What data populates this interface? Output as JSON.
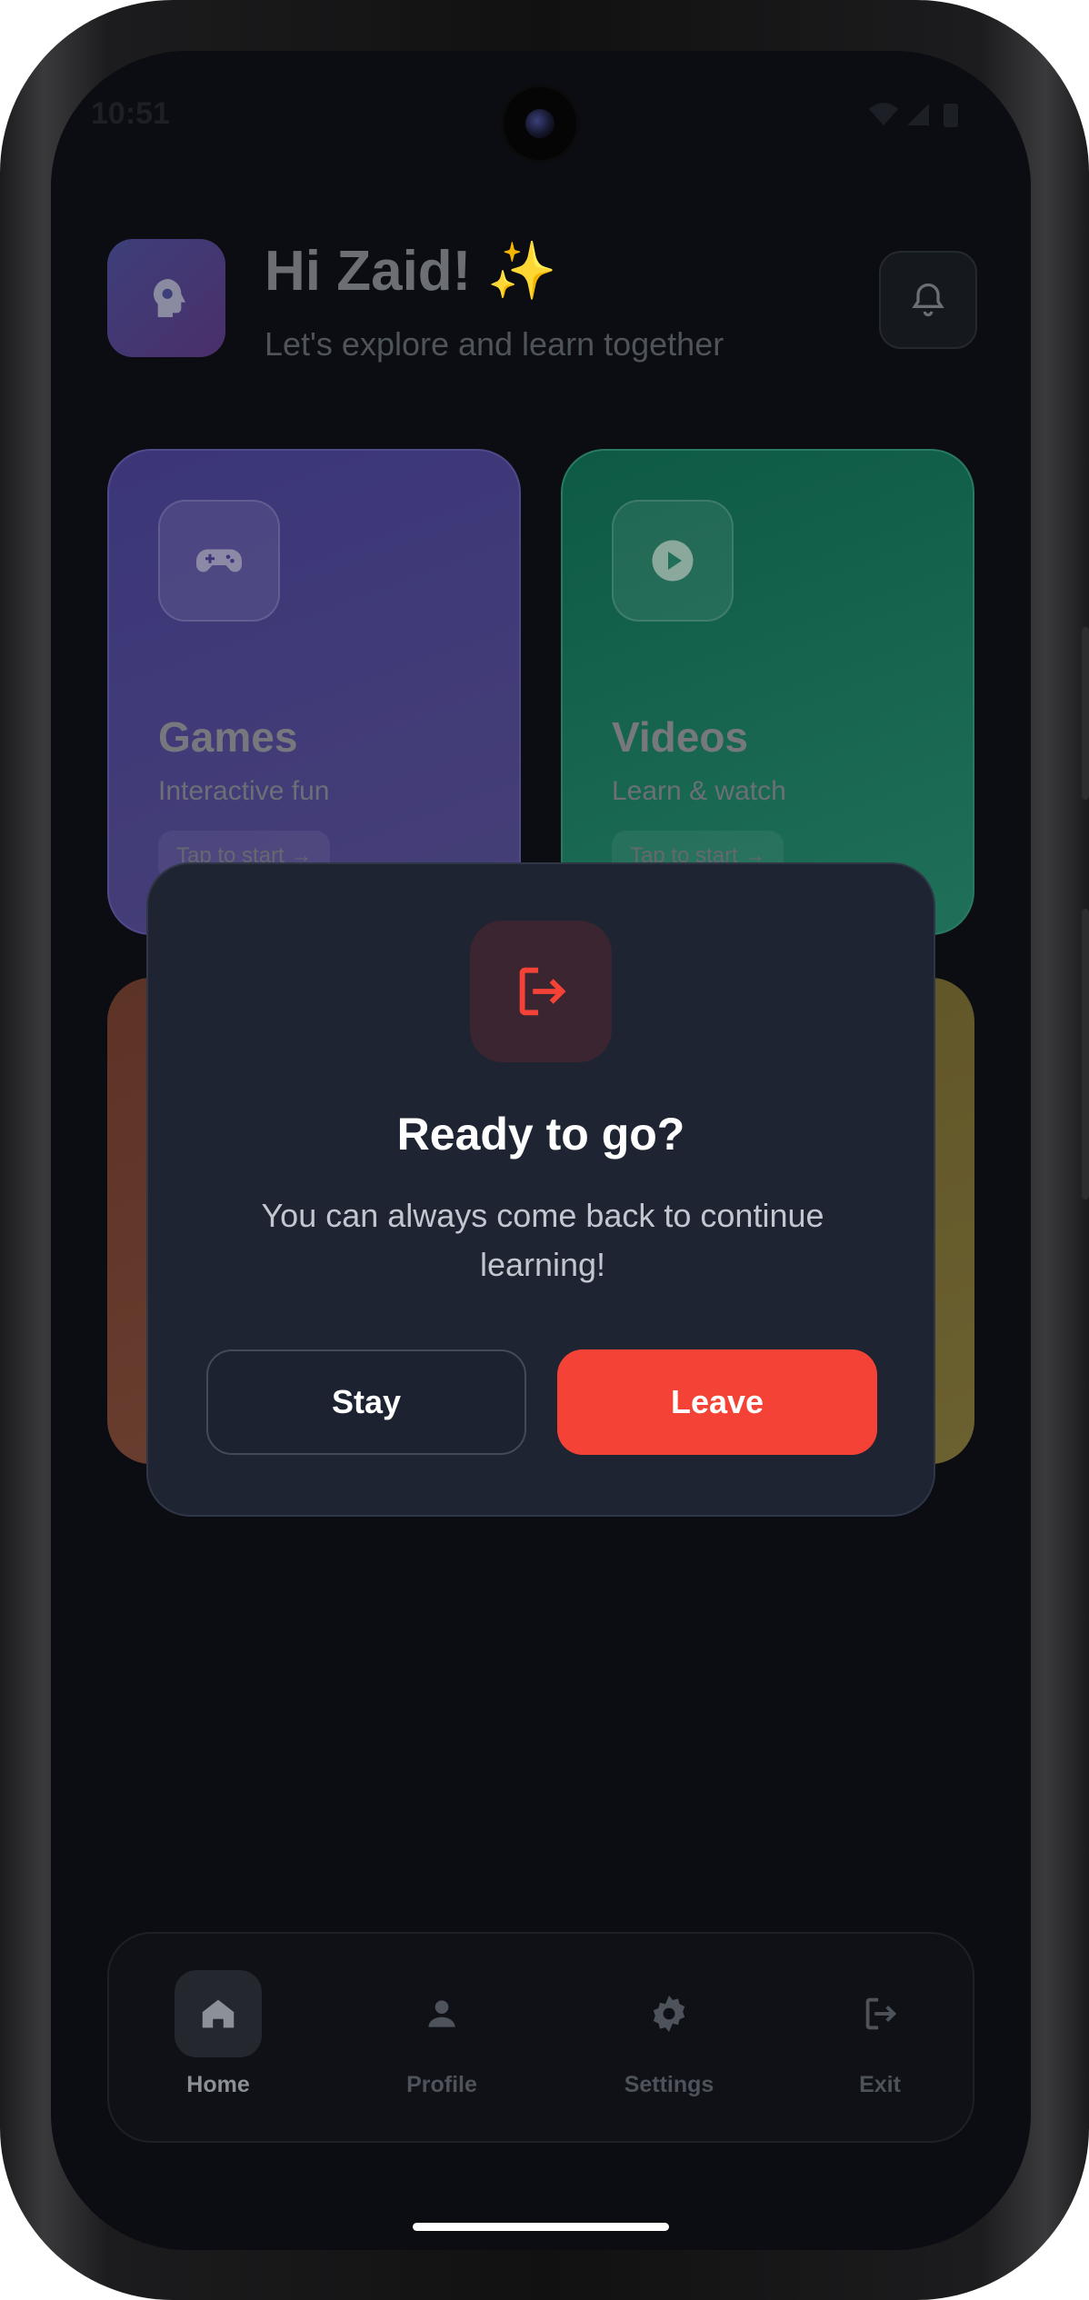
{
  "status_bar": {
    "time": "10:51"
  },
  "header": {
    "greeting": "Hi Zaid! ✨",
    "subtitle": "Let's explore and learn together"
  },
  "cards": [
    {
      "title": "Games",
      "subtitle": "Interactive fun",
      "cta": "Tap to start →",
      "icon": "gamepad-icon",
      "color": "#3b3678"
    },
    {
      "title": "Videos",
      "subtitle": "Learn & watch",
      "cta": "Tap to start →",
      "icon": "play-icon",
      "color": "#0e5a44"
    }
  ],
  "dialog": {
    "title": "Ready to go?",
    "message": "You can always come back to continue learning!",
    "stay_label": "Stay",
    "leave_label": "Leave",
    "icon": "logout-icon",
    "accent_color": "#f44336"
  },
  "nav": {
    "items": [
      {
        "label": "Home",
        "icon": "home-icon",
        "active": true
      },
      {
        "label": "Profile",
        "icon": "person-icon",
        "active": false
      },
      {
        "label": "Settings",
        "icon": "gear-icon",
        "active": false
      },
      {
        "label": "Exit",
        "icon": "logout-icon",
        "active": false
      }
    ]
  }
}
